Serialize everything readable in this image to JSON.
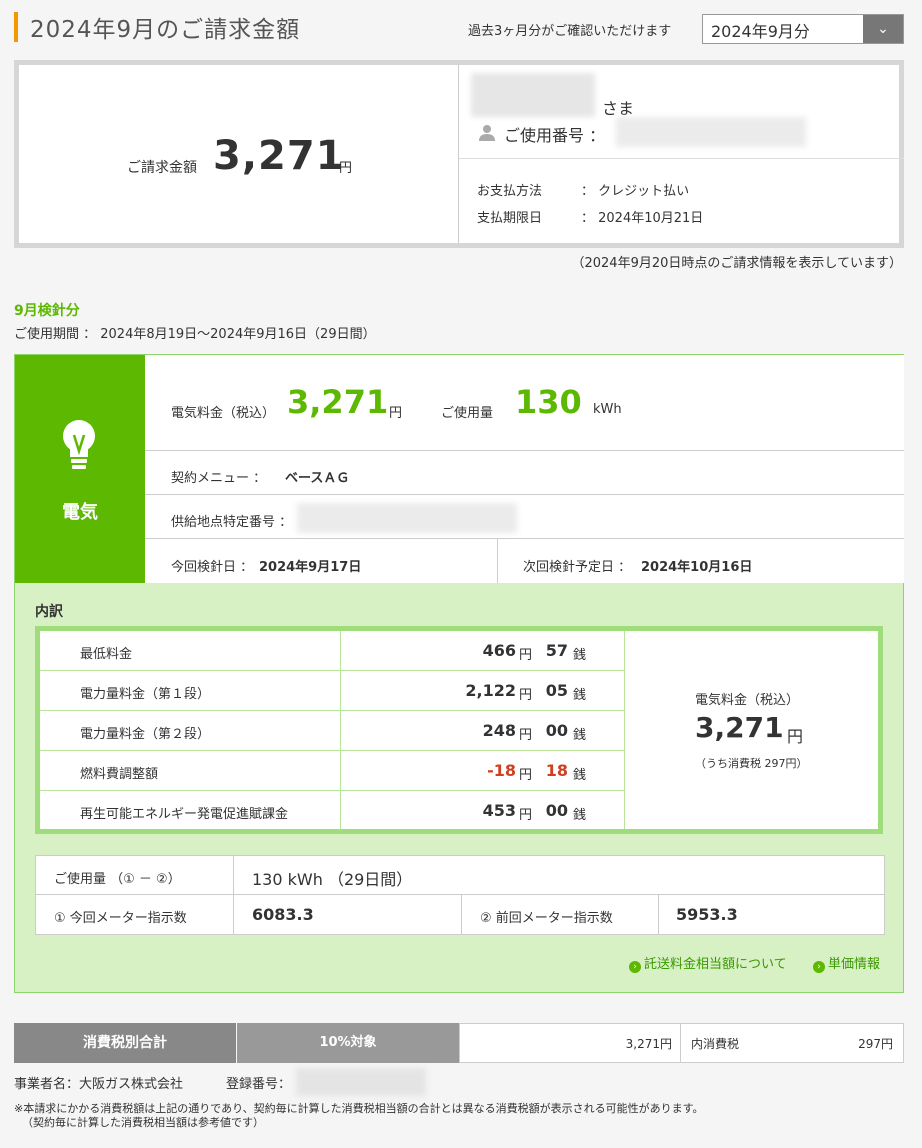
{
  "header": {
    "title": "2024年9月のご請求金額",
    "period_note": "過去3ヶ月分がご確認いただけます",
    "month_select": "2024年9月分"
  },
  "summary": {
    "amount_label": "ご請求金額",
    "amount": "3,271",
    "amount_unit": "円",
    "honorific": "さま",
    "user_no_label": "ご使用番号 ：",
    "pay_method_label": "お支払方法",
    "pay_method_value": "：  クレジット払い",
    "due_label": "支払期限日",
    "due_value": "：  2024年10月21日",
    "as_of_note": "（2024年9月20日時点のご請求情報を表示しています）"
  },
  "period": {
    "reading_month": "9月検針分",
    "usage_period": "ご使用期間 ： 2024年8月19日～2024年9月16日（29日間）"
  },
  "electricity": {
    "label": "電気",
    "fee_label": "電気料金（税込）",
    "fee": "3,271",
    "fee_unit": "円",
    "usage_label": "ご使用量",
    "usage": "130",
    "usage_unit": "kWh",
    "menu_label": "契約メニュー ：",
    "menu_value": "ベースＡＧ",
    "supply_label": "供給地点特定番号 ：",
    "cur_read_label": "今回検針日 ：",
    "cur_read_value": "2024年9月17日",
    "next_read_label": "次回検針予定日 ：",
    "next_read_value": "2024年10月16日"
  },
  "breakdown": {
    "title": "内訳",
    "yen_unit": "円",
    "sen_unit": "銭",
    "rows": [
      {
        "name": "最低料金",
        "yen": "466",
        "sen": "57"
      },
      {
        "name": "電力量料金（第１段）",
        "yen": "2,122",
        "sen": "05"
      },
      {
        "name": "電力量料金（第２段）",
        "yen": "248",
        "sen": "00"
      },
      {
        "name": "燃料費調整額",
        "yen": "-18",
        "sen": "18"
      },
      {
        "name": "再生可能エネルギー発電促進賦課金",
        "yen": "453",
        "sen": "00"
      }
    ],
    "total_label": "電気料金（税込）",
    "total": "3,271",
    "total_unit": "円",
    "tax_note": "（うち消費税 297円）"
  },
  "meter": {
    "usage_label": "ご使用量 （① － ②）",
    "usage_value": "130 kWh  （29日間）",
    "cur_label": "① 今回メーター指示数",
    "cur_value": "6083.3",
    "prev_label": "② 前回メーター指示数",
    "prev_value": "5953.3"
  },
  "links": {
    "consignment": "託送料金相当額について",
    "unit_price": "単価情報"
  },
  "tax": {
    "head": "消費税別合計",
    "rate": "10%対象",
    "amount": "3,271円",
    "inc_label": "内消費税",
    "inc_value": "297円"
  },
  "footer": {
    "biz_name": "事業者名：大阪ガス株式会社",
    "reg_label": "登録番号：",
    "note1": "※本請求にかかる消費税額は上記の通りであり、契約毎に計算した消費税相当額の合計とは異なる消費税額が表示される可能性があります。",
    "note2": "（契約毎に計算した消費税相当額は参考値です）"
  },
  "colors": {
    "accent": "#f39800",
    "green": "#5cb800",
    "panel_bg": "#d7f0c4",
    "negative": "#d0401f"
  }
}
